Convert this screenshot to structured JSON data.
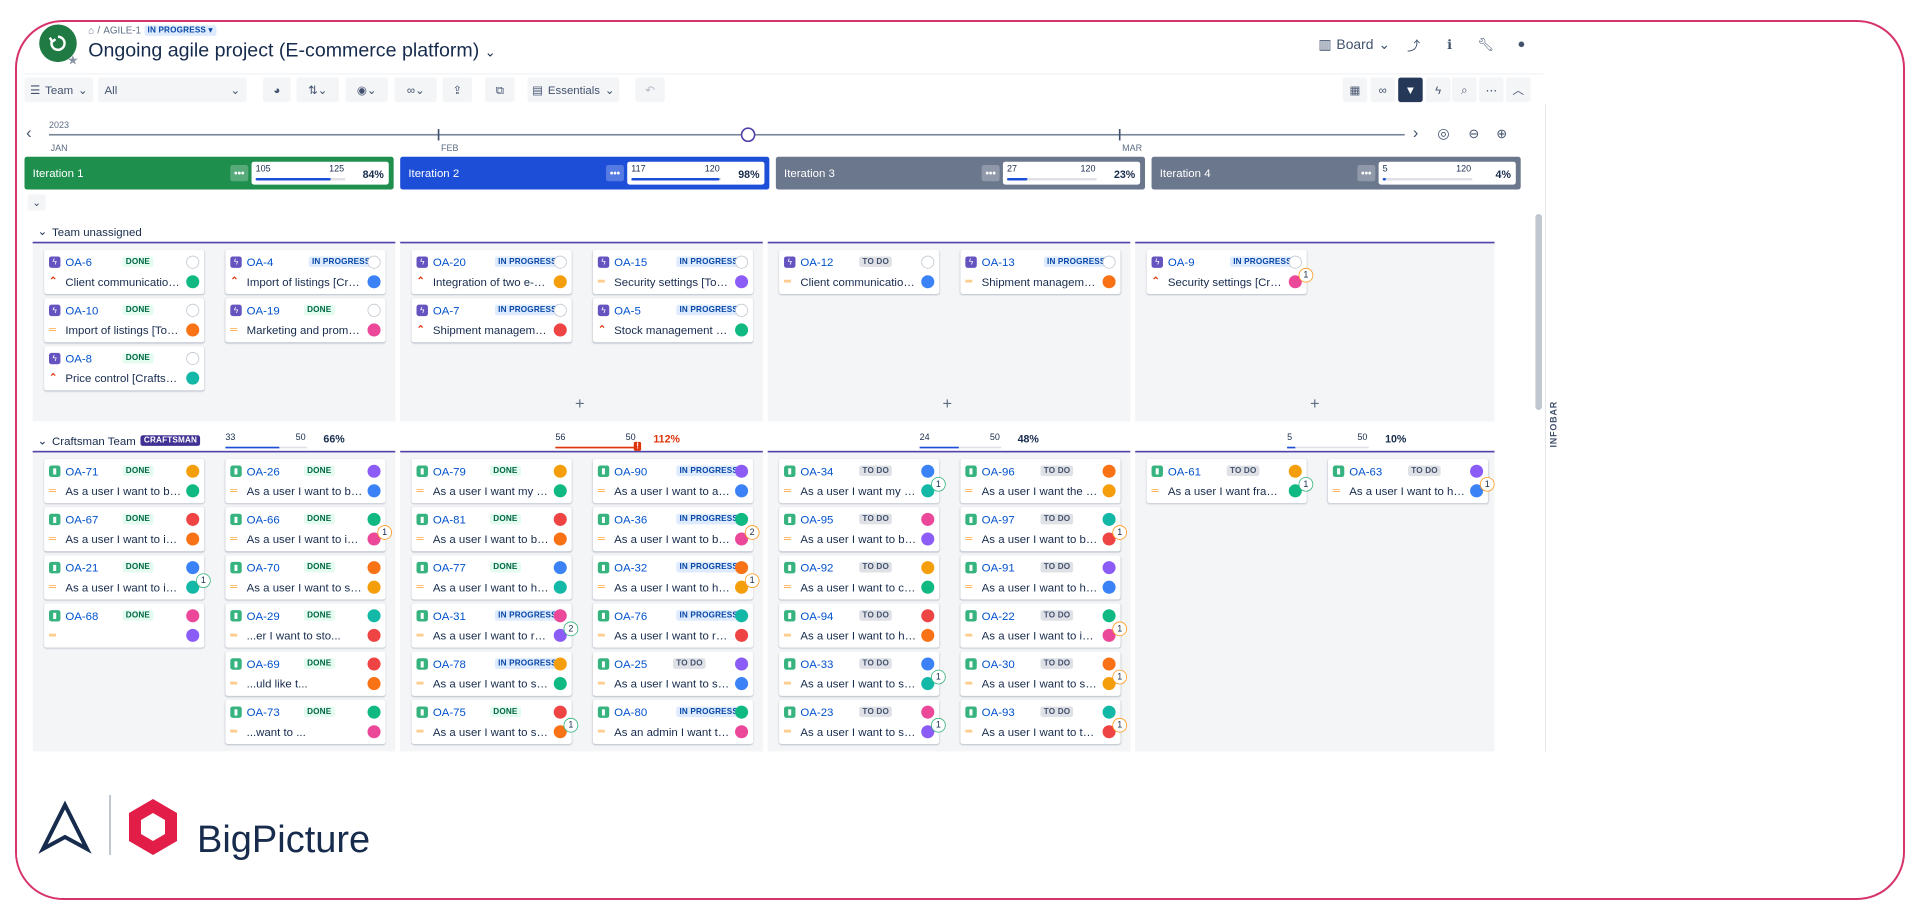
{
  "header": {
    "breadcrumb_key": "AGILE-1",
    "breadcrumb_status": "IN PROGRESS",
    "title": "Ongoing agile project (E-commerce platform)",
    "view_label": "Board"
  },
  "toolbar": {
    "team_label": "Team",
    "filter_value": "All",
    "essentials_label": "Essentials"
  },
  "timeline": {
    "year": "2023",
    "months": [
      "JAN",
      "FEB",
      "MAR"
    ]
  },
  "iterations": [
    {
      "name": "Iteration 1",
      "used": "105",
      "capacity": "125",
      "pct": "84%",
      "fraction": 0.84,
      "color": "#1f8f4e"
    },
    {
      "name": "Iteration 2",
      "used": "117",
      "capacity": "120",
      "pct": "98%",
      "fraction": 0.98,
      "color": "#1d4ed8"
    },
    {
      "name": "Iteration 3",
      "used": "27",
      "capacity": "120",
      "pct": "23%",
      "fraction": 0.23,
      "color": "#6b778c"
    },
    {
      "name": "Iteration 4",
      "used": "5",
      "capacity": "120",
      "pct": "4%",
      "fraction": 0.04,
      "color": "#6b778c"
    }
  ],
  "lanes": [
    {
      "name": "Team unassigned",
      "badge": ""
    },
    {
      "name": "Craftsman Team",
      "badge": "CRAFTSMAN",
      "caps": [
        {
          "used": "33",
          "capacity": "50",
          "pct": "66%",
          "fraction": 0.66,
          "over": false
        },
        {
          "used": "56",
          "capacity": "50",
          "pct": "112%",
          "fraction": 1.0,
          "over": true
        },
        {
          "used": "24",
          "capacity": "50",
          "pct": "48%",
          "fraction": 0.48,
          "over": false
        },
        {
          "used": "5",
          "capacity": "50",
          "pct": "10%",
          "fraction": 0.1,
          "over": false
        }
      ]
    }
  ],
  "cards_unassigned": [
    {
      "key": "OA-6",
      "status": "DONE",
      "summary": "Client communication...",
      "type": "epic",
      "pri": "high"
    },
    {
      "key": "OA-4",
      "status": "IN PROGRESS",
      "summary": "Import of listings [Cra...",
      "type": "epic",
      "pri": "high"
    },
    {
      "key": "OA-10",
      "status": "DONE",
      "summary": "Import of listings [Too...",
      "type": "epic",
      "pri": "med"
    },
    {
      "key": "OA-19",
      "status": "DONE",
      "summary": "Marketing and promot...",
      "type": "epic",
      "pri": "med"
    },
    {
      "key": "OA-8",
      "status": "DONE",
      "summary": "Price control [Craftsm...",
      "type": "epic",
      "pri": "high"
    },
    {
      "key": "OA-20",
      "status": "IN PROGRESS",
      "summary": "Integration of two e-c...",
      "type": "epic",
      "pri": "high"
    },
    {
      "key": "OA-15",
      "status": "IN PROGRESS",
      "summary": "Security settings [Tool...",
      "type": "epic",
      "pri": "med"
    },
    {
      "key": "OA-7",
      "status": "IN PROGRESS",
      "summary": "Shipment manageme...",
      "type": "epic",
      "pri": "high"
    },
    {
      "key": "OA-5",
      "status": "IN PROGRESS",
      "summary": "Stock management [C...",
      "type": "epic",
      "pri": "high"
    },
    {
      "key": "OA-12",
      "status": "TO DO",
      "summary": "Client communication...",
      "type": "epic",
      "pri": "med"
    },
    {
      "key": "OA-13",
      "status": "IN PROGRESS",
      "summary": "Shipment manageme...",
      "type": "epic",
      "pri": "med"
    },
    {
      "key": "OA-9",
      "status": "IN PROGRESS",
      "summary": "Security settings [Craf...",
      "type": "epic",
      "pri": "high",
      "count": "1"
    }
  ],
  "cards_craftsman": [
    {
      "key": "OA-71",
      "status": "DONE",
      "summary": "As a user I want to be ..."
    },
    {
      "key": "OA-26",
      "status": "DONE",
      "summary": "As a user I want to be ..."
    },
    {
      "key": "OA-67",
      "status": "DONE",
      "summary": "As a user I want to im..."
    },
    {
      "key": "OA-66",
      "status": "DONE",
      "summary": "As a user I want to im...",
      "count": "1"
    },
    {
      "key": "OA-21",
      "status": "DONE",
      "summary": "As a user I want to im...",
      "count": "1"
    },
    {
      "key": "OA-70",
      "status": "DONE",
      "summary": "As a user I want to se..."
    },
    {
      "key": "OA-68",
      "status": "DONE",
      "summary": ""
    },
    {
      "key": "OA-29",
      "status": "DONE",
      "summary": "...er I want to sto..."
    },
    {
      "key": "OA-79",
      "status": "DONE",
      "summary": "As a user I want my st..."
    },
    {
      "key": "OA-90",
      "status": "IN PROGRESS",
      "summary": "As a user I want to aut..."
    },
    {
      "key": "OA-81",
      "status": "DONE",
      "summary": "As a user I want to be ..."
    },
    {
      "key": "OA-36",
      "status": "IN PROGRESS",
      "summary": "As a user I want to be ...",
      "count": "2"
    },
    {
      "key": "OA-77",
      "status": "DONE",
      "summary": "As a user I want to ha..."
    },
    {
      "key": "OA-32",
      "status": "IN PROGRESS",
      "summary": "As a user I want to ha...",
      "count": "1"
    },
    {
      "key": "OA-31",
      "status": "IN PROGRESS",
      "summary": "As a user I want to rec...",
      "count": "2"
    },
    {
      "key": "OA-76",
      "status": "IN PROGRESS",
      "summary": "As a user I want to rec..."
    },
    {
      "key": "OA-78",
      "status": "IN PROGRESS",
      "summary": "As a user I want to se..."
    },
    {
      "key": "OA-25",
      "status": "TO DO",
      "summary": "As a user I want to se..."
    },
    {
      "key": "OA-75",
      "status": "DONE",
      "summary": "As a user I want to se...",
      "count": "1"
    },
    {
      "key": "OA-80",
      "status": "IN PROGRESS",
      "summary": "As an admin I want to ..."
    },
    {
      "key": "OA-34",
      "status": "TO DO",
      "summary": "As a user I want my st...",
      "count": "1"
    },
    {
      "key": "OA-96",
      "status": "TO DO",
      "summary": "As a user I want the pl..."
    },
    {
      "key": "OA-95",
      "status": "TO DO",
      "summary": "As a user I want to be ..."
    },
    {
      "key": "OA-97",
      "status": "TO DO",
      "summary": "As a user I want to be ...",
      "count": "1"
    },
    {
      "key": "OA-92",
      "status": "TO DO",
      "summary": "As a user I want to ch..."
    },
    {
      "key": "OA-91",
      "status": "TO DO",
      "summary": "As a user I want to ha..."
    },
    {
      "key": "OA-94",
      "status": "TO DO",
      "summary": "As a user I want to ha..."
    },
    {
      "key": "OA-22",
      "status": "TO DO",
      "summary": "As a user I want to im...",
      "count": "1"
    },
    {
      "key": "OA-33",
      "status": "TO DO",
      "summary": "As a user I want to se...",
      "count": "1"
    },
    {
      "key": "OA-30",
      "status": "TO DO",
      "summary": "As a user I want to se...",
      "count": "1"
    },
    {
      "key": "OA-23",
      "status": "TO DO",
      "summary": "As a user I want to sp...",
      "count": "1"
    },
    {
      "key": "OA-93",
      "status": "TO DO",
      "summary": "As a user I want to tra...",
      "count": "1"
    },
    {
      "key": "OA-61",
      "status": "TO DO",
      "summary": "As a user I want fraud ...",
      "count": "1"
    },
    {
      "key": "OA-63",
      "status": "TO DO",
      "summary": "As a user I want to ha...",
      "count": "1"
    },
    {
      "key": "OA-69",
      "status": "DONE",
      "summary": "...uld like t..."
    },
    {
      "key": "OA-73",
      "status": "DONE",
      "summary": "...want to ..."
    }
  ],
  "infobar_label": "INFOBAR",
  "brand": {
    "name": "BigPicture"
  }
}
